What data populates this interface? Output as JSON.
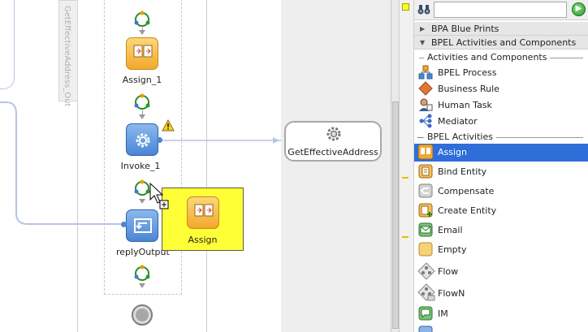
{
  "canvas": {
    "scope_tab_label": "GetEffectiveAddress_Out",
    "activities": [
      {
        "id": "assign1",
        "label": "Assign_1"
      },
      {
        "id": "invoke1",
        "label": "Invoke_1"
      },
      {
        "id": "reply",
        "label": "replyOutput"
      }
    ],
    "partner_link": {
      "label": "GetEffectiveAddress"
    },
    "drag_preview": {
      "label": "Assign"
    }
  },
  "palette": {
    "search": {
      "value": "",
      "placeholder": ""
    },
    "groups": [
      {
        "label": "BPA Blue Prints",
        "expanded": false
      },
      {
        "label": "BPEL Activities and Components",
        "expanded": true
      }
    ],
    "sections": [
      {
        "label": "Activities and Components",
        "items": [
          {
            "label": "BPEL Process",
            "icon": "bpel-process-icon"
          },
          {
            "label": "Business Rule",
            "icon": "business-rule-icon"
          },
          {
            "label": "Human Task",
            "icon": "human-task-icon"
          },
          {
            "label": "Mediator",
            "icon": "mediator-icon"
          }
        ]
      },
      {
        "label": "BPEL Activities",
        "items": [
          {
            "label": "Assign",
            "icon": "assign-icon",
            "selected": true
          },
          {
            "label": "Bind Entity",
            "icon": "bind-entity-icon"
          },
          {
            "label": "Compensate",
            "icon": "compensate-icon"
          },
          {
            "label": "Create Entity",
            "icon": "create-entity-icon"
          },
          {
            "label": "Email",
            "icon": "email-icon"
          },
          {
            "label": "Empty",
            "icon": "empty-icon"
          },
          {
            "label": "Flow",
            "icon": "flow-icon"
          },
          {
            "label": "FlowN",
            "icon": "flown-icon"
          },
          {
            "label": "IM",
            "icon": "im-icon"
          }
        ]
      }
    ]
  },
  "colors": {
    "selection": "#2f6ed8",
    "drag_preview_bg": "#ffff38",
    "assign_orange": "#f2a82a",
    "invoke_blue": "#4a86d4"
  }
}
